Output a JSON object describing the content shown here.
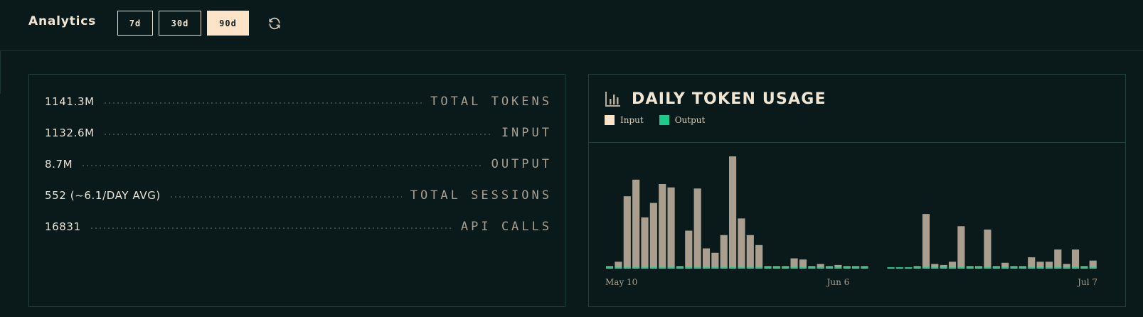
{
  "header": {
    "title": "Analytics",
    "ranges": [
      {
        "label": "7d",
        "active": false
      },
      {
        "label": "30d",
        "active": false
      },
      {
        "label": "90d",
        "active": true
      }
    ],
    "refresh_icon": "refresh-icon"
  },
  "stats": [
    {
      "value": "1141.3M",
      "label": "TOTAL TOKENS"
    },
    {
      "value": "1132.6M",
      "label": "INPUT"
    },
    {
      "value": "8.7M",
      "label": "OUTPUT"
    },
    {
      "value": "552 (~6.1/DAY AVG)",
      "label": "TOTAL SESSIONS"
    },
    {
      "value": "16831",
      "label": "API CALLS"
    }
  ],
  "chart_panel": {
    "title": "DAILY TOKEN USAGE",
    "icon": "bar-chart-icon",
    "legend": [
      {
        "name": "Input",
        "color": "#fde3c8"
      },
      {
        "name": "Output",
        "color": "#1fc98b"
      }
    ]
  },
  "chart_data": {
    "type": "bar",
    "stacked": true,
    "colors": {
      "input": "#aa9f8e",
      "output": "#1fc98b"
    },
    "x_tick_labels": [
      "May 10",
      "Jun 6",
      "Jul 7"
    ],
    "tick_positions": [
      0,
      26,
      51
    ],
    "ylim": [
      0,
      100
    ],
    "series": [
      {
        "name": "Input",
        "values": [
          1,
          5,
          64,
          79,
          45,
          58,
          75,
          72,
          1,
          33,
          71,
          17,
          13,
          29,
          100,
          44,
          29,
          20,
          1,
          1,
          1,
          8,
          7,
          1,
          3,
          1,
          2,
          1,
          1,
          1,
          0,
          0,
          0,
          0,
          0,
          1,
          48,
          3,
          2,
          5,
          37,
          1,
          1,
          34,
          1,
          4,
          1,
          1,
          9,
          5,
          5,
          16,
          3,
          16,
          1,
          6
        ]
      },
      {
        "name": "Output",
        "values": [
          1,
          1,
          1,
          1,
          1,
          1,
          1,
          1,
          1,
          1,
          1,
          1,
          1,
          1,
          1,
          1,
          1,
          1,
          1,
          1,
          1,
          1,
          1,
          1,
          1,
          1,
          1,
          1,
          1,
          1,
          0,
          0,
          1,
          1,
          1,
          1,
          1,
          1,
          1,
          1,
          1,
          1,
          1,
          1,
          1,
          1,
          1,
          1,
          1,
          1,
          1,
          1,
          1,
          1,
          1,
          1
        ]
      }
    ]
  }
}
